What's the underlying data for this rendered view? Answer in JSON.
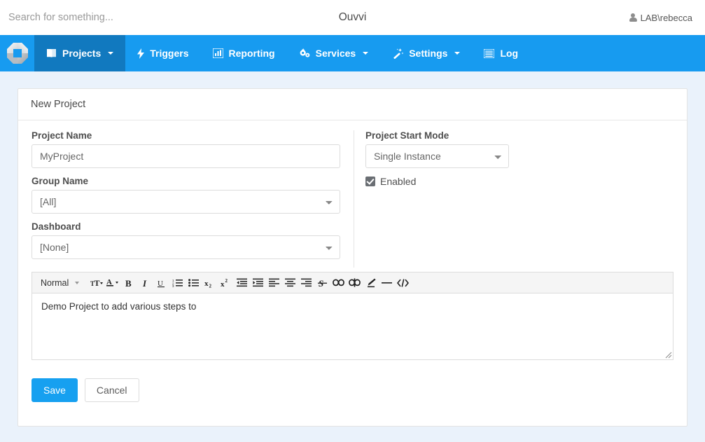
{
  "topbar": {
    "search_placeholder": "Search for something...",
    "search_value": "",
    "app_title": "Ouvvi",
    "user_name": "LAB\\rebecca",
    "user_icon": "user-icon"
  },
  "nav": {
    "logo_icon": "ouvvi-logo-icon",
    "bar_color": "#179bf0",
    "active_color": "#1179bf",
    "items": [
      {
        "label": "Projects",
        "icon": "book-icon",
        "caret": true,
        "active": true
      },
      {
        "label": "Triggers",
        "icon": "bolt-icon",
        "caret": false,
        "active": false
      },
      {
        "label": "Reporting",
        "icon": "bar-chart-icon",
        "caret": false,
        "active": false
      },
      {
        "label": "Services",
        "icon": "gears-icon",
        "caret": true,
        "active": false
      },
      {
        "label": "Settings",
        "icon": "magic-wand-icon",
        "caret": true,
        "active": false
      },
      {
        "label": "Log",
        "icon": "list-icon",
        "caret": false,
        "active": false
      }
    ]
  },
  "card": {
    "title": "New Project"
  },
  "form": {
    "project_name": {
      "label": "Project Name",
      "value": "MyProject",
      "placeholder": ""
    },
    "group_name": {
      "label": "Group Name",
      "value": "[All]",
      "options": [
        "[All]"
      ]
    },
    "dashboard": {
      "label": "Dashboard",
      "value": "[None]",
      "options": [
        "[None]"
      ]
    },
    "start_mode": {
      "label": "Project Start Mode",
      "value": "Single Instance",
      "options": [
        "Single Instance"
      ]
    },
    "enabled": {
      "label": "Enabled",
      "checked": true
    }
  },
  "editor": {
    "style_label": "Normal",
    "content": "Demo Project to add various steps to",
    "tools": [
      {
        "name": "font-size-icon",
        "title": "Font Size"
      },
      {
        "name": "text-color-icon",
        "title": "Text Color"
      },
      {
        "name": "bold-icon",
        "title": "Bold"
      },
      {
        "name": "italic-icon",
        "title": "Italic"
      },
      {
        "name": "underline-icon",
        "title": "Underline"
      },
      {
        "name": "ordered-list-icon",
        "title": "Numbered List"
      },
      {
        "name": "unordered-list-icon",
        "title": "Bullet List"
      },
      {
        "name": "subscript-icon",
        "title": "Subscript"
      },
      {
        "name": "superscript-icon",
        "title": "Superscript"
      },
      {
        "name": "outdent-icon",
        "title": "Outdent"
      },
      {
        "name": "indent-icon",
        "title": "Indent"
      },
      {
        "name": "align-left-icon",
        "title": "Align Left"
      },
      {
        "name": "align-center-icon",
        "title": "Align Center"
      },
      {
        "name": "align-right-icon",
        "title": "Align Right"
      },
      {
        "name": "strikethrough-icon",
        "title": "Strikethrough"
      },
      {
        "name": "link-icon",
        "title": "Insert Link"
      },
      {
        "name": "unlink-icon",
        "title": "Remove Link"
      },
      {
        "name": "highlighter-icon",
        "title": "Highlight"
      },
      {
        "name": "horizontal-rule-icon",
        "title": "Horizontal Rule"
      },
      {
        "name": "code-icon",
        "title": "Source Code"
      }
    ]
  },
  "actions": {
    "save_label": "Save",
    "cancel_label": "Cancel",
    "primary_color": "#16a0f0"
  }
}
